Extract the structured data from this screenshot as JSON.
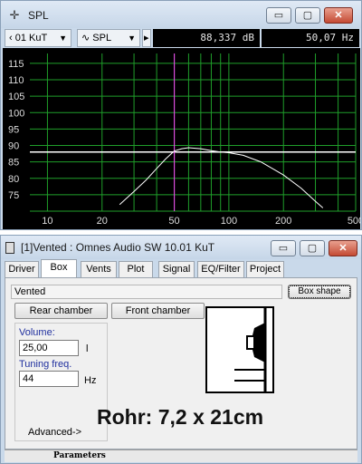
{
  "spl_window": {
    "title": "SPL",
    "controls": {
      "minimize": "▭",
      "maximize": "▢",
      "close": "✕"
    },
    "toolbar": {
      "driver_selector": "‹ 01 KuT",
      "curve_selector": "∿ SPL",
      "next_arrow": "▸",
      "spl_readout": "88,337 dB",
      "freq_readout": "50,07 Hz"
    },
    "chart_data": {
      "type": "line",
      "title": "",
      "xlabel": "",
      "ylabel": "",
      "x_scale": "log",
      "xlim": [
        8,
        500
      ],
      "ylim": [
        70,
        118
      ],
      "x_ticks": [
        10,
        20,
        50,
        100,
        200,
        500
      ],
      "y_ticks": [
        75,
        80,
        85,
        90,
        95,
        100,
        105,
        110,
        115
      ],
      "grid": true,
      "cursor": {
        "x": 50.07,
        "y": 88.337
      },
      "reference_level": 88,
      "series": [
        {
          "color": "#ffffff",
          "points": [
            [
              25,
              72
            ],
            [
              30,
              76
            ],
            [
              35,
              79.5
            ],
            [
              40,
              83
            ],
            [
              45,
              86
            ],
            [
              50,
              88.3
            ],
            [
              55,
              89
            ],
            [
              60,
              89.3
            ],
            [
              70,
              89
            ],
            [
              80,
              88.4
            ],
            [
              90,
              88
            ],
            [
              100,
              87.8
            ],
            [
              120,
              87
            ],
            [
              150,
              85
            ],
            [
              200,
              81
            ],
            [
              250,
              77
            ],
            [
              300,
              73
            ],
            [
              330,
              71
            ]
          ]
        }
      ]
    }
  },
  "box_window": {
    "title": "[1]Vented : Omnes Audio SW 10.01 KuT",
    "controls": {
      "minimize": "▭",
      "maximize": "▢",
      "close": "✕"
    },
    "tabs": [
      "Driver",
      "Box",
      "Vents",
      "Plot",
      "Signal",
      "EQ/Filter",
      "Project"
    ],
    "active_tab": "Box",
    "box_name": "Vented",
    "box_shape_button": "Box shape",
    "rear_chamber_button": "Rear chamber",
    "front_chamber_button": "Front chamber",
    "volume_label": "Volume:",
    "volume_value": "25,00",
    "volume_unit": "l",
    "tuning_label": "Tuning freq.",
    "tuning_value": "44",
    "tuning_unit": "Hz",
    "advanced_label": "Advanced->",
    "status_tab": "Parameters"
  },
  "overlay_text": "Rohr: 7,2 x 21cm"
}
